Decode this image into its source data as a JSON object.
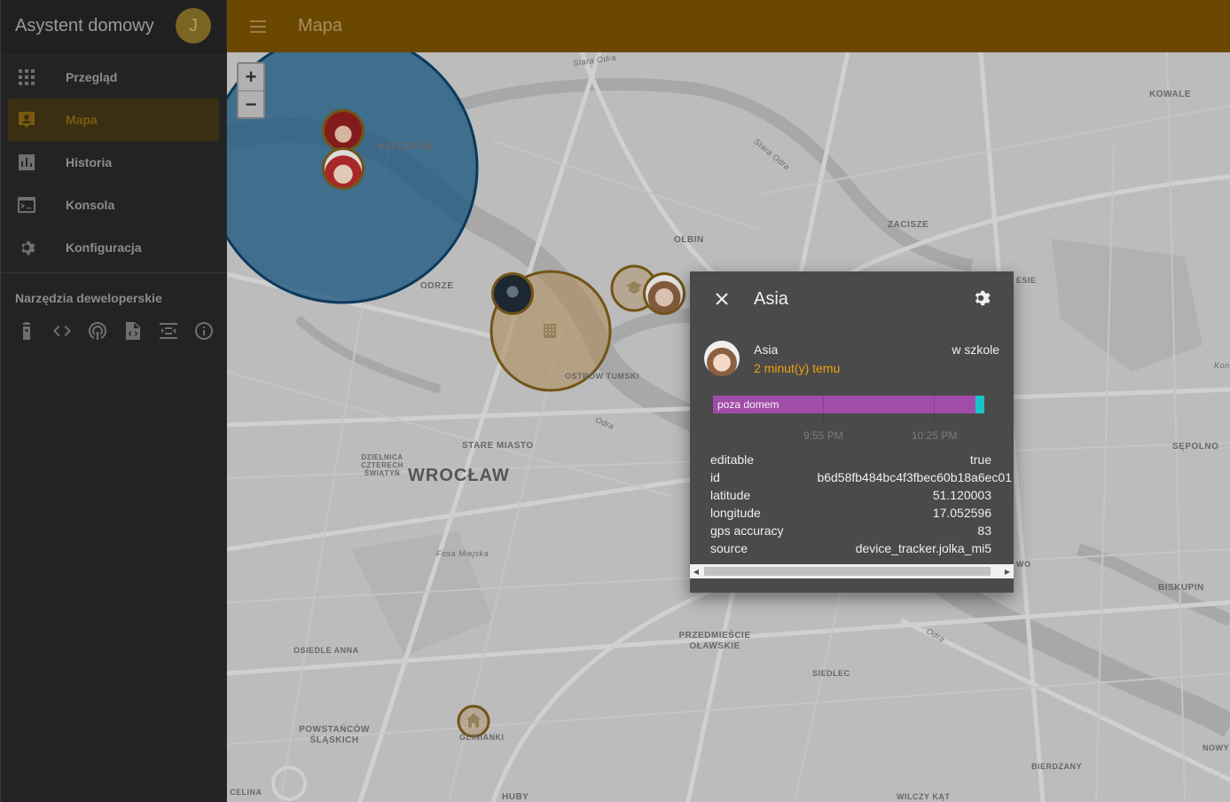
{
  "app": {
    "title": "Asystent domowy",
    "user_initial": "J"
  },
  "sidebar": {
    "items": [
      {
        "label": "Przegląd",
        "icon": "grid-icon"
      },
      {
        "label": "Mapa",
        "icon": "account-location-icon"
      },
      {
        "label": "Historia",
        "icon": "chart-bar-icon"
      },
      {
        "label": "Konsola",
        "icon": "console-icon"
      },
      {
        "label": "Konfiguracja",
        "icon": "gear-icon"
      }
    ],
    "dev_title": "Narzędzia deweloperskie",
    "dev_tools": [
      "remote-icon",
      "code-icon",
      "podcast-icon",
      "file-xml-icon",
      "mqtt-icon",
      "info-icon"
    ]
  },
  "topbar": {
    "title": "Mapa"
  },
  "map": {
    "zoom_in": "+",
    "zoom_out": "−",
    "labels": {
      "kleczkow": "KLECZKÓW",
      "olbin": "OŁBIN",
      "zacisze": "ZACISZE",
      "kowale": "KOWALE",
      "odrze": "ODRZE",
      "ostrow": "OSTRÓW TUMSKI",
      "stare_miasto": "STARE MIASTO",
      "dzielnica": "DZIELNICA CZTERECH ŚWIĄTYŃ",
      "wroclaw": "WROCŁAW",
      "fosa": "Fosa Miejska",
      "sepolno": "SĘPOLNO",
      "biskupin": "BISKUPIN",
      "osiedle_anna": "OSIEDLE ANNA",
      "przedmiescie": "PRZEDMIEŚCIE OŁAWSKIE",
      "siedlec": "SIEDLEC",
      "powstancow": "POWSTAŃCÓW ŚLĄSKICH",
      "gliniaki": "GLINIANKI",
      "bierdzany": "BIERDZANY",
      "celina": "CELINA",
      "huby": "HUBY",
      "wilczy_kat": "WILCZY KĄT",
      "nowy": "NOWY",
      "stara_odra": "Stara Odra",
      "odra": "Odra",
      "esie": "ESIE",
      "wo": "WO",
      "kon": "Kon"
    }
  },
  "dialog": {
    "title": "Asia",
    "entity_name": "Asia",
    "last_changed": "2 minut(y) temu",
    "state": "w szkole",
    "timeline": {
      "label": "poza domem",
      "ticks": [
        "9:55 PM",
        "10:25 PM"
      ]
    },
    "attributes": [
      {
        "key": "editable",
        "value": "true"
      },
      {
        "key": "id",
        "value": "b6d58fb484bc4f3fbec60b18a6ec01"
      },
      {
        "key": "latitude",
        "value": "51.120003"
      },
      {
        "key": "longitude",
        "value": "17.052596"
      },
      {
        "key": "gps accuracy",
        "value": "83"
      },
      {
        "key": "source",
        "value": "device_tracker.jolka_mi5"
      }
    ]
  },
  "colors": {
    "topbar": "#6b4800",
    "accent": "#f0a20a",
    "timeline_away": "#a14ca8",
    "timeline_zone": "#19c4c9"
  }
}
